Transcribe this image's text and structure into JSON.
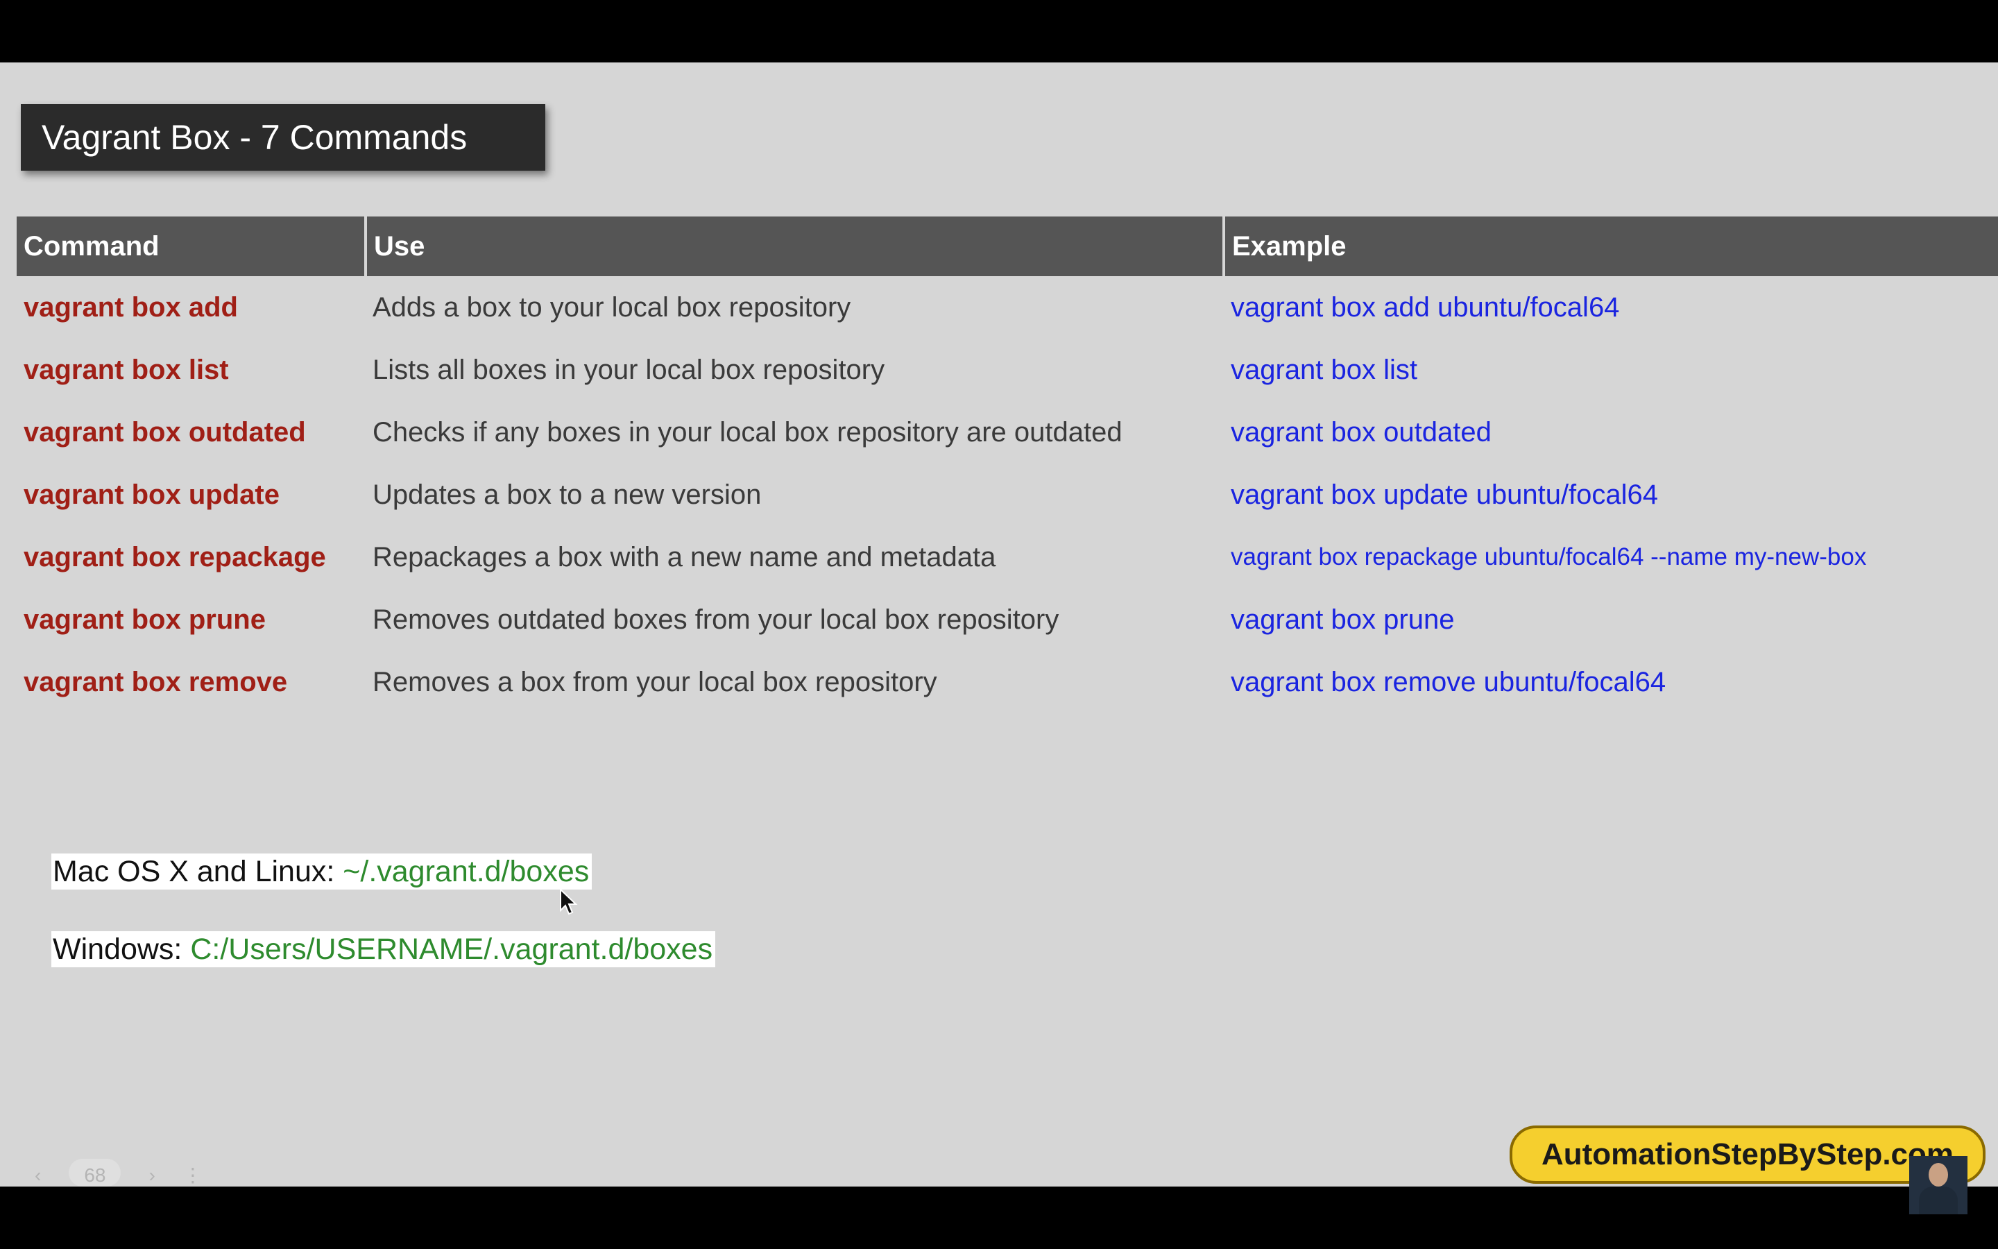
{
  "title": "Vagrant Box - 7 Commands",
  "table": {
    "headers": [
      "Command",
      "Use",
      "Example"
    ],
    "rows": [
      {
        "command": "vagrant box add",
        "use": "Adds a box to your local box repository",
        "example": "vagrant box add ubuntu/focal64"
      },
      {
        "command": "vagrant box list",
        "use": "Lists all boxes in your local box repository",
        "example": "vagrant box list"
      },
      {
        "command": "vagrant box outdated",
        "use": "Checks if any boxes in your local box repository are outdated",
        "example": "vagrant box outdated"
      },
      {
        "command": "vagrant box update",
        "use": "Updates a box to a new version",
        "example": "vagrant box update ubuntu/focal64"
      },
      {
        "command": "vagrant box repackage",
        "use": "Repackages a box with a new name and metadata",
        "example": "vagrant box repackage ubuntu/focal64 --name my-new-box"
      },
      {
        "command": "vagrant box prune",
        "use": "Removes outdated boxes from your local box repository",
        "example": "vagrant box prune"
      },
      {
        "command": "vagrant box remove",
        "use": "Removes a box from your local box repository",
        "example": "vagrant box remove ubuntu/focal64"
      }
    ]
  },
  "paths": {
    "mac_label": "Mac OS X and Linux: ",
    "mac_path": "~/.vagrant.d/boxes",
    "windows_label": "Windows: ",
    "windows_path": "C:/Users/USERNAME/.vagrant.d/boxes"
  },
  "brand": "AutomationStepByStep.com",
  "slide_nav": {
    "prev": "‹",
    "page": "68",
    "next": "›",
    "more": "⋮"
  },
  "colors": {
    "slide_bg": "#d6d6d6",
    "title_bg": "#2b2b2b",
    "header_bg": "#555555",
    "command": "#a01f16",
    "example": "#1a24e0",
    "path": "#2e8b2e",
    "brand_bg": "#f5cf2e"
  },
  "icons": [
    "mouse-pointer-icon",
    "presenter-avatar"
  ]
}
